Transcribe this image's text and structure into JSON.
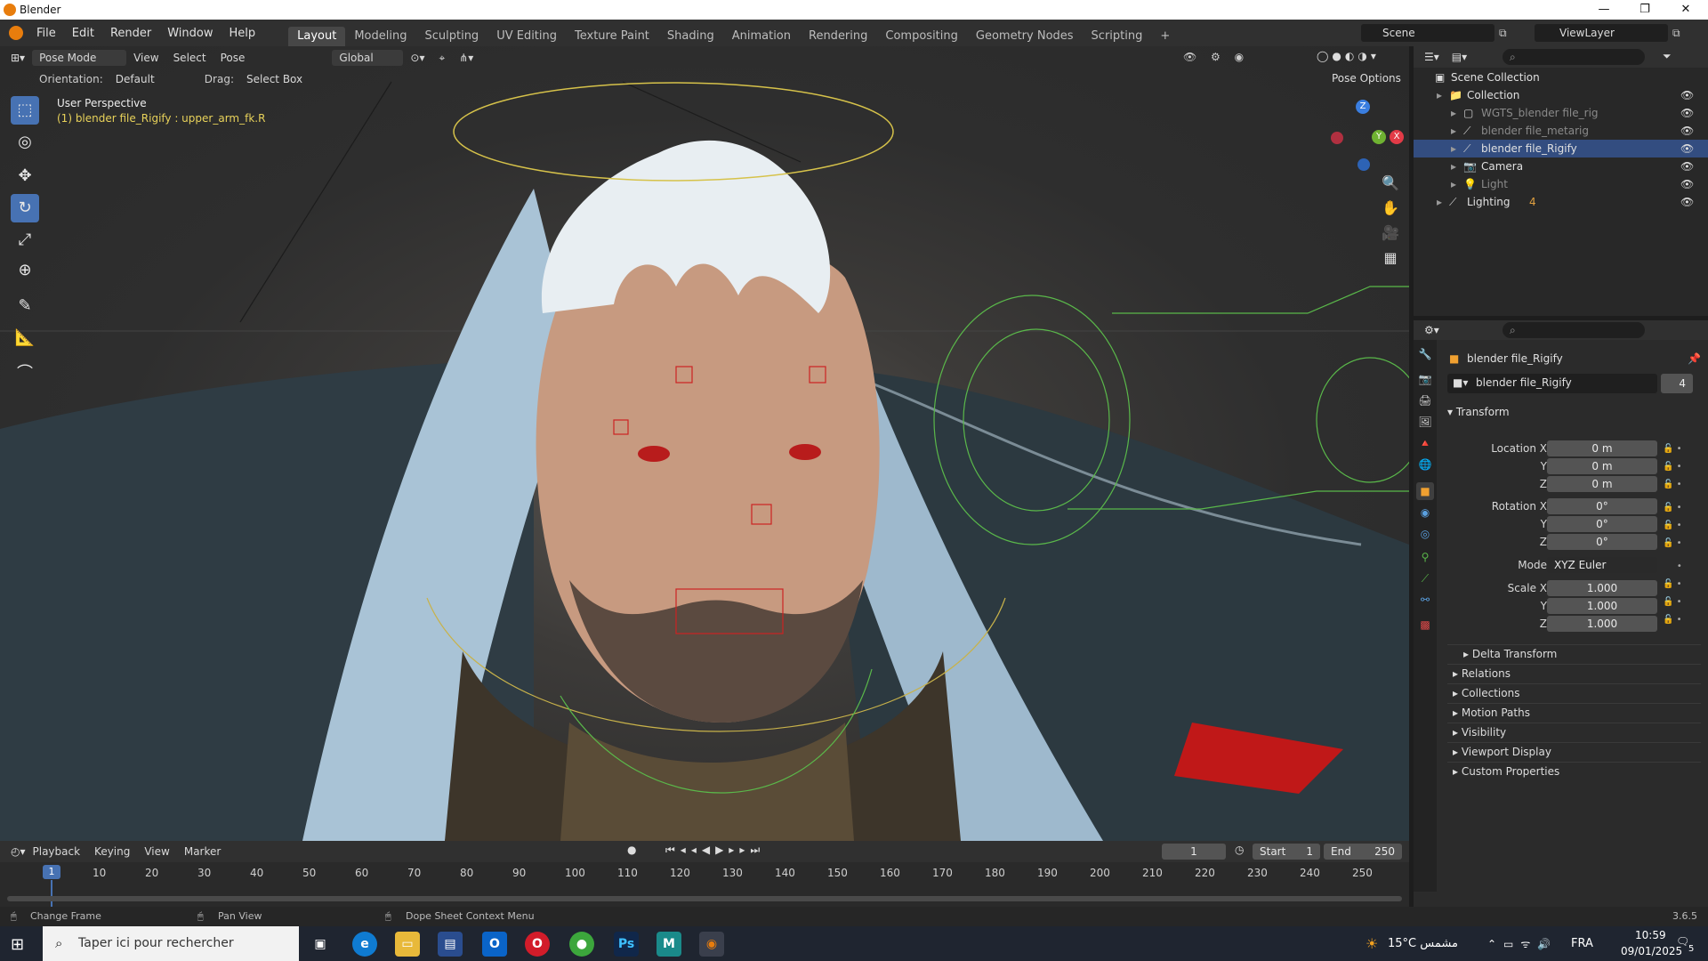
{
  "window": {
    "title": "Blender",
    "controls": [
      "—",
      "❐",
      "✕"
    ]
  },
  "menubar": {
    "menus": [
      "File",
      "Edit",
      "Render",
      "Window",
      "Help"
    ],
    "workspaces": [
      "Layout",
      "Modeling",
      "Sculpting",
      "UV Editing",
      "Texture Paint",
      "Shading",
      "Animation",
      "Rendering",
      "Compositing",
      "Geometry Nodes",
      "Scripting"
    ],
    "active_workspace": "Layout",
    "scene": "Scene",
    "view_layer": "ViewLayer"
  },
  "viewport": {
    "mode": "Pose Mode",
    "menus": [
      "View",
      "Select",
      "Pose"
    ],
    "transform_orientation": "Global",
    "orientation_label": "Orientation:",
    "orientation_value": "Default",
    "drag_label": "Drag:",
    "drag_value": "Select Box",
    "pose_options": "Pose Options",
    "perspective_text": "User Perspective",
    "active_object_text": "(1) blender file_Rigify : upper_arm_fk.R",
    "gizmo_axes": {
      "z": "Z",
      "y": "Y",
      "x": "X"
    },
    "accent_bone_color": "#d6c24a"
  },
  "outliner": {
    "root": "Scene Collection",
    "items": [
      {
        "label": "Collection",
        "indent": 1,
        "selected": false,
        "dim": false
      },
      {
        "label": "WGTS_blender file_rig",
        "indent": 2,
        "selected": false,
        "dim": true
      },
      {
        "label": "blender file_metarig",
        "indent": 2,
        "selected": false,
        "dim": true
      },
      {
        "label": "blender file_Rigify",
        "indent": 2,
        "selected": true,
        "dim": false
      },
      {
        "label": "Camera",
        "indent": 2,
        "selected": false,
        "dim": false
      },
      {
        "label": "Light",
        "indent": 2,
        "selected": false,
        "dim": true
      },
      {
        "label": "Lighting",
        "indent": 1,
        "selected": false,
        "dim": false,
        "badge": "4"
      }
    ]
  },
  "properties": {
    "object_name": "blender file_Rigify",
    "data_name": "blender file_Rigify",
    "users": "4",
    "transform_header": "Transform",
    "location_label": "Location X",
    "location": [
      "0 m",
      "0 m",
      "0 m"
    ],
    "rotation_label": "Rotation X",
    "rotation": [
      "0°",
      "0°",
      "0°"
    ],
    "mode_label": "Mode",
    "mode_value": "XYZ Euler",
    "scale_label": "Scale X",
    "scale": [
      "1.000",
      "1.000",
      "1.000"
    ],
    "y_label": "Y",
    "z_label": "Z",
    "subpanels": [
      "Delta Transform",
      "Relations",
      "Collections",
      "Motion Paths",
      "Visibility",
      "Viewport Display",
      "Custom Properties"
    ]
  },
  "timeline": {
    "menus": [
      "Playback",
      "Keying",
      "View",
      "Marker"
    ],
    "current_frame": "1",
    "start_label": "Start",
    "start": "1",
    "end_label": "End",
    "end": "250",
    "ticks": [
      "10",
      "20",
      "30",
      "40",
      "50",
      "60",
      "70",
      "80",
      "90",
      "100",
      "110",
      "120",
      "130",
      "140",
      "150",
      "160",
      "170",
      "180",
      "190",
      "200",
      "210",
      "220",
      "230",
      "240",
      "250"
    ],
    "playhead": "1"
  },
  "statusbar": {
    "hints": [
      "Change Frame",
      "Pan View",
      "Dope Sheet Context Menu"
    ],
    "version": "3.6.5"
  },
  "taskbar": {
    "search_placeholder": "Taper ici pour rechercher",
    "weather": "15°C مشمس",
    "lang": "FRA",
    "time": "10:59",
    "date": "09/01/2025",
    "notifications": "5"
  }
}
